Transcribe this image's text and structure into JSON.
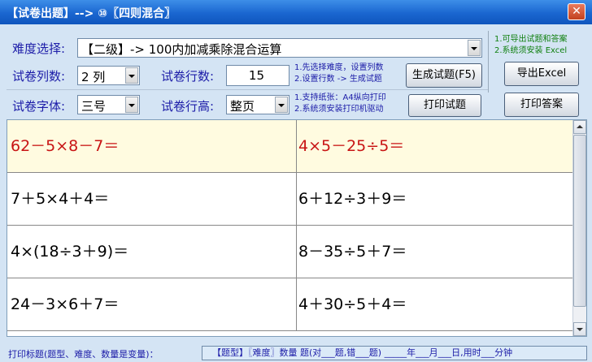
{
  "window": {
    "title": "【试卷出题】--> ⑩〖四则混合〗",
    "close_glyph": "✕"
  },
  "controls": {
    "difficulty": {
      "label": "难度选择:",
      "value": "【二级】-> 100内加减乘除混合运算"
    },
    "columns": {
      "label": "试卷列数:",
      "value": "2 列"
    },
    "rows": {
      "label": "试卷行数:",
      "value": "15"
    },
    "font": {
      "label": "试卷字体:",
      "value": "三号"
    },
    "row_height": {
      "label": "试卷行高:",
      "value": "整页"
    },
    "generate_hint": [
      "1.先选择难度，设置列数",
      "2.设置行数 -> 生成试题"
    ],
    "print_hint": [
      "1.支持纸张：A4纵向打印",
      "2.系统须安装打印机驱动"
    ],
    "export_hint": [
      "1.可导出试题和答案",
      "2.系统须安装 Excel"
    ],
    "generate_button": "生成试题(F5)",
    "print_button": "打印试题",
    "export_button": "导出Excel",
    "print_answer_button": "打印答案"
  },
  "questions": [
    [
      "62－5×8－7＝",
      "4×5－25÷5＝"
    ],
    [
      "7＋5×4＋4＝",
      "6＋12÷3＋9＝"
    ],
    [
      "4×(18÷3＋9)＝",
      "8－35÷5＋7＝"
    ],
    [
      "24－3×6＋7＝",
      "4＋30÷5＋4＝"
    ]
  ],
  "status": {
    "label": "打印标题(题型、难度、数量是变量)：",
    "value": "【题型】〖难度〗数量 题(对___题,错___题) _____年___月___日,用时___分钟"
  },
  "colors": {
    "title_bar": "#1a66d0",
    "label_text": "#1c1ca8",
    "hint_green": "#108010",
    "selected_row_text": "#c81414",
    "selected_row_bg": "#fffbe0"
  }
}
